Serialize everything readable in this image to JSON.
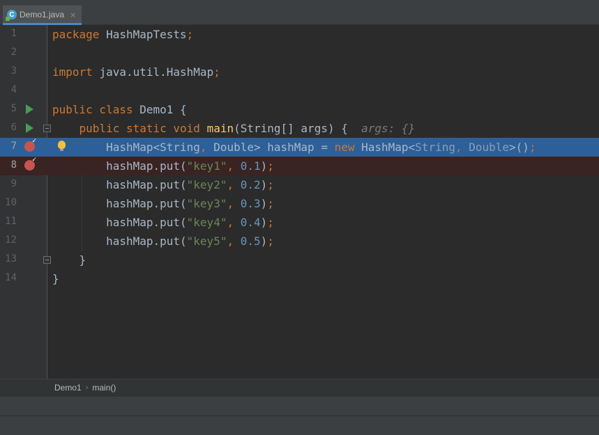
{
  "tab": {
    "label": "Demo1.java",
    "close": "×",
    "icon": "java-class-icon"
  },
  "breadcrumb": {
    "items": [
      "Demo1",
      "main()"
    ],
    "separator": "›"
  },
  "code": {
    "lines": [
      {
        "n": "1",
        "segments": [
          [
            "kw",
            "package "
          ],
          [
            "",
            "HashMapTests"
          ],
          [
            "kw",
            ";"
          ]
        ]
      },
      {
        "n": "2",
        "segments": []
      },
      {
        "n": "3",
        "segments": [
          [
            "kw",
            "import "
          ],
          [
            "",
            "java.util.HashMap"
          ],
          [
            "kw",
            ";"
          ]
        ]
      },
      {
        "n": "4",
        "segments": []
      },
      {
        "n": "5",
        "segments": [
          [
            "kw",
            "public class "
          ],
          [
            "",
            "Demo1 {"
          ]
        ]
      },
      {
        "n": "6",
        "segments": [
          [
            "",
            "    "
          ],
          [
            "kw",
            "public static void "
          ],
          [
            "fn",
            "main"
          ],
          [
            "",
            "(String[] args) {  "
          ],
          [
            "hint",
            "args: {}"
          ]
        ]
      },
      {
        "n": "7",
        "segments": [
          [
            "",
            "        HashMap<String"
          ],
          [
            "kw",
            ", "
          ],
          [
            "",
            "Double> hashMap = "
          ],
          [
            "kw",
            "new "
          ],
          [
            "",
            "HashMap<"
          ],
          [
            "dim",
            "String"
          ],
          [
            "kw",
            ", "
          ],
          [
            "dim",
            "Double"
          ],
          [
            "",
            "&gt;()"
          ],
          [
            "kw",
            ";"
          ]
        ]
      },
      {
        "n": "8",
        "segments": [
          [
            "",
            "        hashMap.put("
          ],
          [
            "str",
            "\"key1\""
          ],
          [
            "kw",
            ", "
          ],
          [
            "num",
            "0.1"
          ],
          [
            "",
            ")"
          ],
          [
            "kw",
            ";"
          ]
        ]
      },
      {
        "n": "9",
        "segments": [
          [
            "",
            "        hashMap.put("
          ],
          [
            "str",
            "\"key2\""
          ],
          [
            "kw",
            ", "
          ],
          [
            "num",
            "0.2"
          ],
          [
            "",
            ")"
          ],
          [
            "kw",
            ";"
          ]
        ]
      },
      {
        "n": "10",
        "segments": [
          [
            "",
            "        hashMap.put("
          ],
          [
            "str",
            "\"key3\""
          ],
          [
            "kw",
            ", "
          ],
          [
            "num",
            "0.3"
          ],
          [
            "",
            ")"
          ],
          [
            "kw",
            ";"
          ]
        ]
      },
      {
        "n": "11",
        "segments": [
          [
            "",
            "        hashMap.put("
          ],
          [
            "str",
            "\"key4\""
          ],
          [
            "kw",
            ", "
          ],
          [
            "num",
            "0.4"
          ],
          [
            "",
            ")"
          ],
          [
            "kw",
            ";"
          ]
        ]
      },
      {
        "n": "12",
        "segments": [
          [
            "",
            "        hashMap.put("
          ],
          [
            "str",
            "\"key5\""
          ],
          [
            "kw",
            ", "
          ],
          [
            "num",
            "0.5"
          ],
          [
            "",
            ")"
          ],
          [
            "kw",
            ";"
          ]
        ]
      },
      {
        "n": "13",
        "segments": [
          [
            "",
            "    }"
          ]
        ]
      },
      {
        "n": "14",
        "segments": [
          [
            "",
            "}"
          ]
        ]
      }
    ],
    "run_lines": [
      "5",
      "6"
    ],
    "breakpoint_lines": [
      "7",
      "8"
    ],
    "fold_lines": [
      "6",
      "13"
    ],
    "current_line": "7",
    "error_line": "8",
    "intention_bulb_line": "7"
  },
  "colors": {
    "background": "#2b2b2b",
    "gutter": "#313335",
    "keyword": "#cc7832",
    "string": "#6a8759",
    "number": "#6897bb",
    "method": "#ffc66d",
    "current_line": "#2f65a5",
    "breakpoint": "#c75450"
  }
}
